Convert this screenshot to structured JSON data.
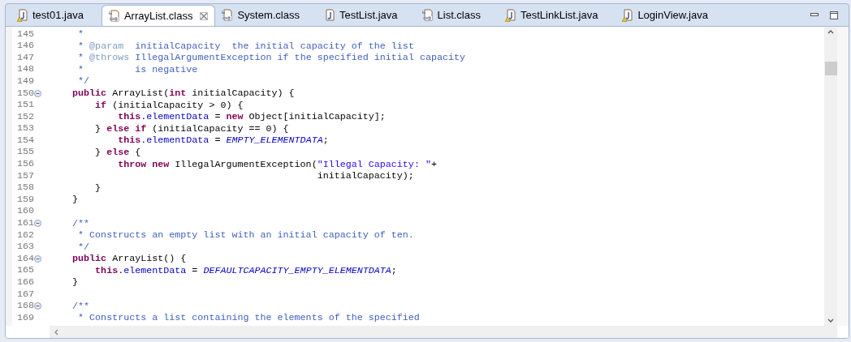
{
  "tabs": [
    {
      "label": "test01.java",
      "kind": "java",
      "warning": true,
      "selected": false,
      "closable": false
    },
    {
      "label": "ArrayList.class",
      "kind": "class",
      "warning": false,
      "selected": true,
      "closable": true
    },
    {
      "label": "System.class",
      "kind": "class",
      "warning": false,
      "selected": false,
      "closable": false
    },
    {
      "label": "TestList.java",
      "kind": "java",
      "warning": false,
      "selected": false,
      "closable": false
    },
    {
      "label": "List.class",
      "kind": "class",
      "warning": false,
      "selected": false,
      "closable": false
    },
    {
      "label": "TestLinkList.java",
      "kind": "java",
      "warning": true,
      "selected": false,
      "closable": false
    },
    {
      "label": "LoginView.java",
      "kind": "java",
      "warning": true,
      "selected": false,
      "closable": false
    }
  ],
  "editor": {
    "lines": [
      {
        "number": "145",
        "foldable": false,
        "tokens": [
          {
            "kind": "comment",
            "text": "     *"
          }
        ]
      },
      {
        "number": "146",
        "foldable": false,
        "tokens": [
          {
            "kind": "comment",
            "text": "     * "
          },
          {
            "kind": "tag",
            "text": "@param"
          },
          {
            "kind": "comment",
            "text": "  initialCapacity  the initial capacity of the list"
          }
        ]
      },
      {
        "number": "147",
        "foldable": false,
        "tokens": [
          {
            "kind": "comment",
            "text": "     * "
          },
          {
            "kind": "tag",
            "text": "@throws"
          },
          {
            "kind": "comment",
            "text": " IllegalArgumentException if the specified initial capacity"
          }
        ]
      },
      {
        "number": "148",
        "foldable": false,
        "tokens": [
          {
            "kind": "comment",
            "text": "     *         is negative"
          }
        ]
      },
      {
        "number": "149",
        "foldable": false,
        "tokens": [
          {
            "kind": "comment",
            "text": "     */"
          }
        ]
      },
      {
        "number": "150",
        "foldable": true,
        "tokens": [
          {
            "kind": "keyword",
            "text": "    public"
          },
          {
            "kind": "plain",
            "text": " ArrayList("
          },
          {
            "kind": "keyword",
            "text": "int"
          },
          {
            "kind": "plain",
            "text": " initialCapacity) {"
          }
        ]
      },
      {
        "number": "151",
        "foldable": false,
        "tokens": [
          {
            "kind": "keyword",
            "text": "        if"
          },
          {
            "kind": "plain",
            "text": " (initialCapacity > 0) {"
          }
        ]
      },
      {
        "number": "152",
        "foldable": false,
        "tokens": [
          {
            "kind": "keyword",
            "text": "            this"
          },
          {
            "kind": "plain",
            "text": "."
          },
          {
            "kind": "field",
            "text": "elementData"
          },
          {
            "kind": "plain",
            "text": " = "
          },
          {
            "kind": "keyword",
            "text": "new"
          },
          {
            "kind": "plain",
            "text": " Object[initialCapacity];"
          }
        ]
      },
      {
        "number": "153",
        "foldable": false,
        "tokens": [
          {
            "kind": "plain",
            "text": "        } "
          },
          {
            "kind": "keyword",
            "text": "else if"
          },
          {
            "kind": "plain",
            "text": " (initialCapacity == 0) {"
          }
        ]
      },
      {
        "number": "154",
        "foldable": false,
        "tokens": [
          {
            "kind": "keyword",
            "text": "            this"
          },
          {
            "kind": "plain",
            "text": "."
          },
          {
            "kind": "field",
            "text": "elementData"
          },
          {
            "kind": "plain",
            "text": " = "
          },
          {
            "kind": "static",
            "text": "EMPTY_ELEMENTDATA"
          },
          {
            "kind": "plain",
            "text": ";"
          }
        ]
      },
      {
        "number": "155",
        "foldable": false,
        "tokens": [
          {
            "kind": "plain",
            "text": "        } "
          },
          {
            "kind": "keyword",
            "text": "else"
          },
          {
            "kind": "plain",
            "text": " {"
          }
        ]
      },
      {
        "number": "156",
        "foldable": false,
        "tokens": [
          {
            "kind": "keyword",
            "text": "            throw new"
          },
          {
            "kind": "plain",
            "text": " IllegalArgumentException("
          },
          {
            "kind": "string",
            "text": "\"Illegal Capacity: \""
          },
          {
            "kind": "plain",
            "text": "+"
          }
        ]
      },
      {
        "number": "157",
        "foldable": false,
        "tokens": [
          {
            "kind": "plain",
            "text": "                                               initialCapacity);"
          }
        ]
      },
      {
        "number": "158",
        "foldable": false,
        "tokens": [
          {
            "kind": "plain",
            "text": "        }"
          }
        ]
      },
      {
        "number": "159",
        "foldable": false,
        "tokens": [
          {
            "kind": "plain",
            "text": "    }"
          }
        ]
      },
      {
        "number": "160",
        "foldable": false
      },
      {
        "number": "161",
        "foldable": true,
        "tokens": [
          {
            "kind": "comment",
            "text": "    /**"
          }
        ]
      },
      {
        "number": "162",
        "foldable": false,
        "tokens": [
          {
            "kind": "comment",
            "text": "     * Constructs an empty list with an initial capacity of ten."
          }
        ]
      },
      {
        "number": "163",
        "foldable": false,
        "tokens": [
          {
            "kind": "comment",
            "text": "     */"
          }
        ]
      },
      {
        "number": "164",
        "foldable": true,
        "tokens": [
          {
            "kind": "keyword",
            "text": "    public"
          },
          {
            "kind": "plain",
            "text": " ArrayList() {"
          }
        ]
      },
      {
        "number": "165",
        "foldable": false,
        "tokens": [
          {
            "kind": "keyword",
            "text": "        this"
          },
          {
            "kind": "plain",
            "text": "."
          },
          {
            "kind": "field",
            "text": "elementData"
          },
          {
            "kind": "plain",
            "text": " = "
          },
          {
            "kind": "static",
            "text": "DEFAULTCAPACITY_EMPTY_ELEMENTDATA"
          },
          {
            "kind": "plain",
            "text": ";"
          }
        ]
      },
      {
        "number": "166",
        "foldable": false,
        "tokens": [
          {
            "kind": "plain",
            "text": "    }"
          }
        ]
      },
      {
        "number": "167",
        "foldable": false
      },
      {
        "number": "168",
        "foldable": true,
        "tokens": [
          {
            "kind": "comment",
            "text": "    /**"
          }
        ]
      },
      {
        "number": "169",
        "foldable": false,
        "tokens": [
          {
            "kind": "comment",
            "text": "     * Constructs a list containing the elements of the specified"
          }
        ]
      }
    ]
  }
}
